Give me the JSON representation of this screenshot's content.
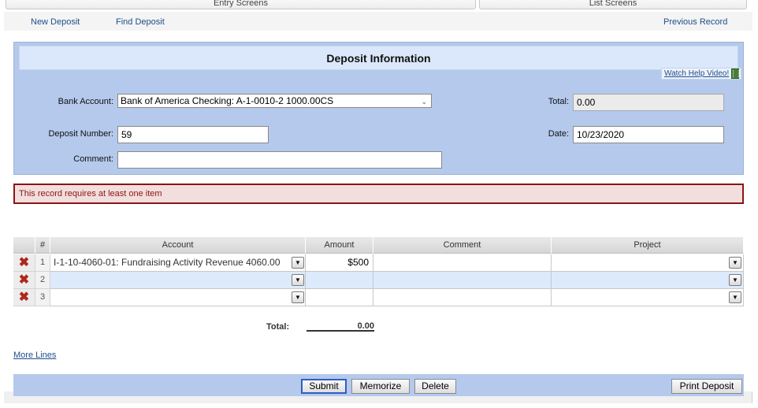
{
  "top_tabs": {
    "entry_screens": "Entry Screens",
    "list_screens": "List Screens"
  },
  "nav": {
    "new_deposit": "New Deposit",
    "find_deposit": "Find Deposit",
    "previous_record": "Previous Record"
  },
  "form": {
    "title": "Deposit Information",
    "help_link": "Watch Help Video!",
    "bank_account_label": "Bank Account:",
    "bank_account_value": "Bank of America Checking: A-1-0010-2 1000.00CS",
    "total_label": "Total:",
    "total_value": "0.00",
    "deposit_number_label": "Deposit Number:",
    "deposit_number_value": "59",
    "date_label": "Date:",
    "date_value": "10/23/2020",
    "comment_label": "Comment:",
    "comment_value": ""
  },
  "error_message": "This record requires at least one item",
  "grid": {
    "headers": {
      "num": "#",
      "account": "Account",
      "amount": "Amount",
      "comment": "Comment",
      "project": "Project"
    },
    "rows": [
      {
        "num": "1",
        "account": "I-1-10-4060-01: Fundraising Activity Revenue 4060.00",
        "amount": "$500",
        "comment": "",
        "project": ""
      },
      {
        "num": "2",
        "account": "",
        "amount": "",
        "comment": "",
        "project": ""
      },
      {
        "num": "3",
        "account": "",
        "amount": "",
        "comment": "",
        "project": ""
      }
    ],
    "total_label": "Total:",
    "total_value": "0.00"
  },
  "more_lines": "More Lines",
  "footer": {
    "submit": "Submit",
    "memorize": "Memorize",
    "delete": "Delete",
    "print_deposit": "Print Deposit"
  },
  "colors": {
    "panel": "#b4c9ec",
    "title_bar": "#dbe7fb",
    "error_border": "#8c1414",
    "error_bg": "#f3dede",
    "link": "#1f4d8a",
    "delete_icon": "#b0261a"
  }
}
